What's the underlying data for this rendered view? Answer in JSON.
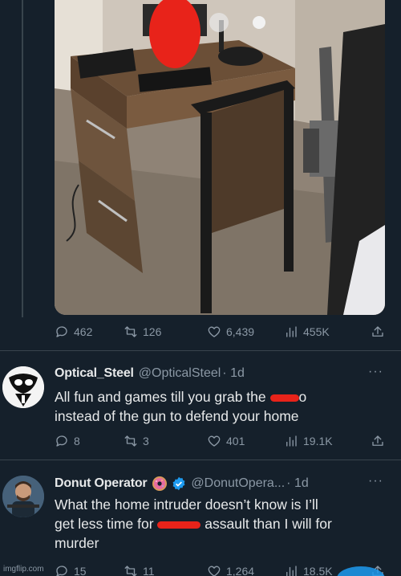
{
  "main_tweet": {
    "stats": {
      "replies": "462",
      "retweets": "126",
      "likes": "6,439",
      "views": "455K"
    }
  },
  "replies": [
    {
      "display_name": "Optical_Steel",
      "handle": "@OpticalSteel",
      "time": "· 1d",
      "more": "···",
      "text_1": "All fun and games till you grab the ",
      "text_redacted_tail": "o",
      "text_2": "instead of the gun to defend your home",
      "stats": {
        "replies": "8",
        "retweets": "3",
        "likes": "401",
        "views": "19.1K"
      }
    },
    {
      "display_name": "Donut Operator",
      "emoji": "donut-emoji",
      "verified": true,
      "handle": "@DonutOpera...",
      "time": "· 1d",
      "more": "···",
      "text_1": "What the home intruder doesn’t know is I’ll",
      "text_2a": "get less time for ",
      "text_2b": " assault than I will for",
      "text_3": "murder",
      "stats": {
        "replies": "15",
        "retweets": "11",
        "likes": "1,264",
        "views": "18.5K"
      }
    }
  ],
  "watermark": "imgflip.com",
  "colors": {
    "background": "#15202b",
    "text": "#e7e9ea",
    "muted": "#8b98a5",
    "accent": "#1d9bf0",
    "redaction": "#e8231a"
  }
}
